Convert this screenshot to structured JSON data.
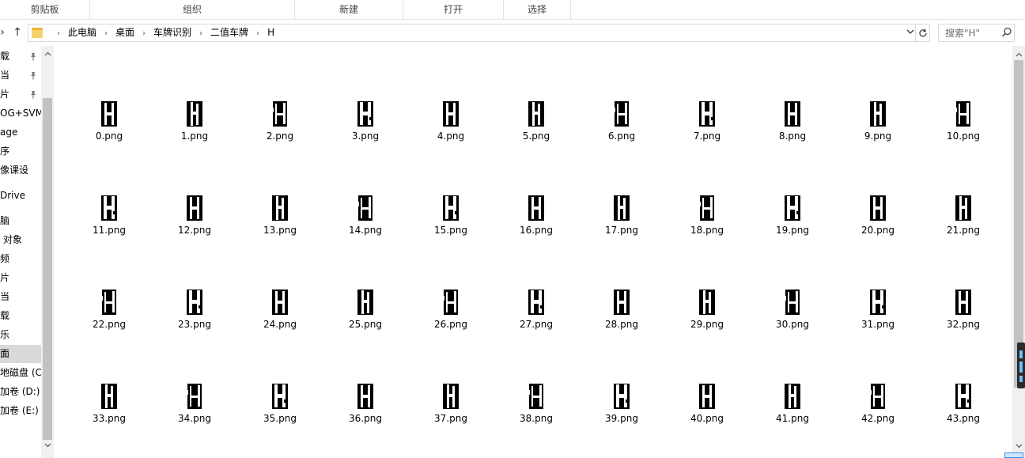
{
  "ribbon": {
    "groups": [
      "剪贴板",
      "组织",
      "新建",
      "打开",
      "选择"
    ]
  },
  "address": {
    "crumbs": [
      "此电脑",
      "桌面",
      "车牌识别",
      "二值车牌",
      "H"
    ],
    "separator": "›"
  },
  "search": {
    "placeholder": "搜索\"H\""
  },
  "nav_pane": {
    "items": [
      {
        "label": "载",
        "pinned": true
      },
      {
        "label": "当",
        "pinned": true
      },
      {
        "label": "片",
        "pinned": true
      },
      {
        "label": "OG+SVM数",
        "pinned": false
      },
      {
        "label": "age",
        "pinned": false
      },
      {
        "label": "序",
        "pinned": false
      },
      {
        "label": "像课设",
        "pinned": false
      },
      {
        "label": "Drive",
        "pinned": false
      },
      {
        "label": "脑",
        "pinned": false
      },
      {
        "label": " 对象",
        "pinned": false
      },
      {
        "label": "频",
        "pinned": false
      },
      {
        "label": "片",
        "pinned": false
      },
      {
        "label": "当",
        "pinned": false
      },
      {
        "label": "载",
        "pinned": false
      },
      {
        "label": "乐",
        "pinned": false
      },
      {
        "label": "面",
        "pinned": false,
        "selected": true
      },
      {
        "label": "地磁盘 (C:",
        "pinned": false
      },
      {
        "label": "加卷 (D:)",
        "pinned": false
      },
      {
        "label": "加卷 (E:)",
        "pinned": false
      }
    ]
  },
  "files": [
    "0.png",
    "1.png",
    "2.png",
    "3.png",
    "4.png",
    "5.png",
    "6.png",
    "7.png",
    "8.png",
    "9.png",
    "10.png",
    "11.png",
    "12.png",
    "13.png",
    "14.png",
    "15.png",
    "16.png",
    "17.png",
    "18.png",
    "19.png",
    "20.png",
    "21.png",
    "22.png",
    "23.png",
    "24.png",
    "25.png",
    "26.png",
    "27.png",
    "28.png",
    "29.png",
    "30.png",
    "31.png",
    "32.png",
    "33.png",
    "34.png",
    "35.png",
    "36.png",
    "37.png",
    "38.png",
    "39.png",
    "40.png",
    "41.png",
    "42.png",
    "43.png"
  ],
  "colors": {
    "selected_bg": "#d9d9d9",
    "folder": "#f5d26b",
    "scroll_thumb": "#c2c2c2"
  }
}
